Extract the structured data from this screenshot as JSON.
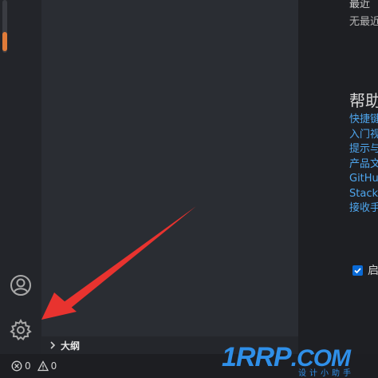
{
  "recent": {
    "title": "最近",
    "empty_text": "无最近"
  },
  "help": {
    "title": "帮助",
    "links": [
      "快捷键",
      "入门视",
      "提示与",
      "产品文",
      "GitHu",
      "Stack",
      "接收手"
    ]
  },
  "startup": {
    "label": "启"
  },
  "outline": {
    "label": "大纲"
  },
  "status": {
    "errors": "0",
    "warnings": "0"
  },
  "watermark": {
    "brand": "1RRP",
    "domain": ".COM",
    "tagline": "设计小助手"
  },
  "colors": {
    "accent": "#e07b39",
    "link": "#4ea6ee",
    "arrow": "#e8332f",
    "checkbox": "#0a6ad6"
  },
  "icons": [
    "account-icon",
    "gear-icon",
    "chevron-right-icon",
    "error-icon",
    "warning-icon",
    "check-icon",
    "arrow-annotation"
  ]
}
